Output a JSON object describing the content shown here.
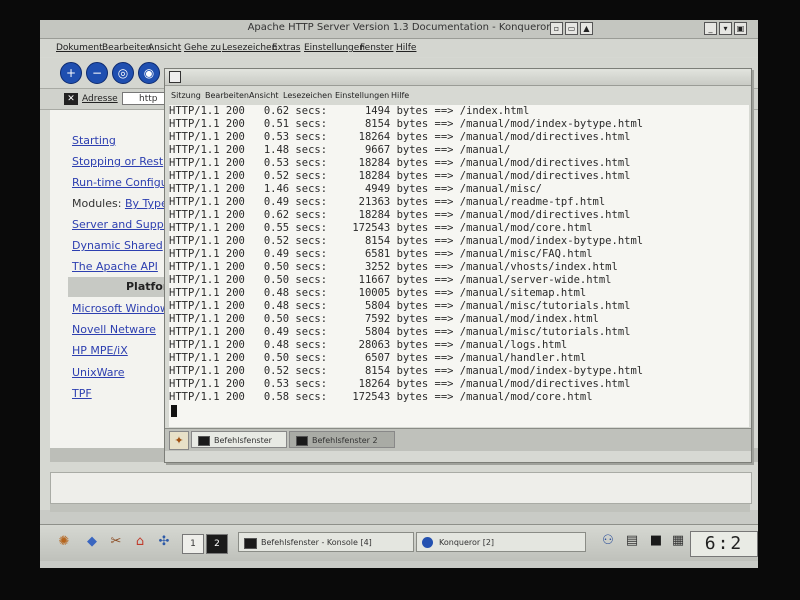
{
  "konqueror": {
    "title": "Apache HTTP Server Version 1.3 Documentation - Konqueror",
    "menu": [
      "Dokument",
      "Bearbeiten",
      "Ansicht",
      "Gehe zu",
      "Lesezeichen",
      "Extras",
      "Einstellungen",
      "Fenster",
      "Hilfe"
    ],
    "location_label": "Adresse",
    "location_value": "http",
    "sidebar": {
      "starting": "Starting",
      "stopping": "Stopping or Rest",
      "runtime": "Run-time Configu",
      "modules_prefix": "Modules: ",
      "modules_link": "By Type",
      "server": "Server and Suppo",
      "dynamic": "Dynamic Shared",
      "api": "The Apache API",
      "platform_heading": "Platfor",
      "microsoft": "Microsoft Window",
      "novell": "Novell Netware",
      "hp": "HP MPE/iX",
      "unixware": "UnixWare",
      "tpf": "TPF"
    }
  },
  "konsole": {
    "menu": [
      "Sitzung",
      "Bearbeiten",
      "Ansicht",
      "Lesezeichen",
      "Einstellungen",
      "Hilfe"
    ],
    "tabs": [
      "Befehlsfenster",
      "Befehlsfenster 2"
    ],
    "log": [
      {
        "status": "HTTP/1.1 200",
        "time": "0.62",
        "bytes": "1494",
        "path": "/index.html"
      },
      {
        "status": "HTTP/1.1 200",
        "time": "0.51",
        "bytes": "8154",
        "path": "/manual/mod/index-bytype.html"
      },
      {
        "status": "HTTP/1.1 200",
        "time": "0.53",
        "bytes": "18264",
        "path": "/manual/mod/directives.html"
      },
      {
        "status": "HTTP/1.1 200",
        "time": "1.48",
        "bytes": "9667",
        "path": "/manual/"
      },
      {
        "status": "HTTP/1.1 200",
        "time": "0.53",
        "bytes": "18284",
        "path": "/manual/mod/directives.html"
      },
      {
        "status": "HTTP/1.1 200",
        "time": "0.52",
        "bytes": "18284",
        "path": "/manual/mod/directives.html"
      },
      {
        "status": "HTTP/1.1 200",
        "time": "1.46",
        "bytes": "4949",
        "path": "/manual/misc/"
      },
      {
        "status": "HTTP/1.1 200",
        "time": "0.49",
        "bytes": "21363",
        "path": "/manual/readme-tpf.html"
      },
      {
        "status": "HTTP/1.1 200",
        "time": "0.62",
        "bytes": "18284",
        "path": "/manual/mod/directives.html"
      },
      {
        "status": "HTTP/1.1 200",
        "time": "0.55",
        "bytes": "172543",
        "path": "/manual/mod/core.html"
      },
      {
        "status": "HTTP/1.1 200",
        "time": "0.52",
        "bytes": "8154",
        "path": "/manual/mod/index-bytype.html"
      },
      {
        "status": "HTTP/1.1 200",
        "time": "0.49",
        "bytes": "6581",
        "path": "/manual/misc/FAQ.html"
      },
      {
        "status": "HTTP/1.1 200",
        "time": "0.50",
        "bytes": "3252",
        "path": "/manual/vhosts/index.html"
      },
      {
        "status": "HTTP/1.1 200",
        "time": "0.50",
        "bytes": "11667",
        "path": "/manual/server-wide.html"
      },
      {
        "status": "HTTP/1.1 200",
        "time": "0.48",
        "bytes": "10005",
        "path": "/manual/sitemap.html"
      },
      {
        "status": "HTTP/1.1 200",
        "time": "0.48",
        "bytes": "5804",
        "path": "/manual/misc/tutorials.html"
      },
      {
        "status": "HTTP/1.1 200",
        "time": "0.50",
        "bytes": "7592",
        "path": "/manual/mod/index.html"
      },
      {
        "status": "HTTP/1.1 200",
        "time": "0.49",
        "bytes": "5804",
        "path": "/manual/misc/tutorials.html"
      },
      {
        "status": "HTTP/1.1 200",
        "time": "0.48",
        "bytes": "28063",
        "path": "/manual/logs.html"
      },
      {
        "status": "HTTP/1.1 200",
        "time": "0.50",
        "bytes": "6507",
        "path": "/manual/handler.html"
      },
      {
        "status": "HTTP/1.1 200",
        "time": "0.52",
        "bytes": "8154",
        "path": "/manual/mod/index-bytype.html"
      },
      {
        "status": "HTTP/1.1 200",
        "time": "0.53",
        "bytes": "18264",
        "path": "/manual/mod/directives.html"
      },
      {
        "status": "HTTP/1.1 200",
        "time": "0.58",
        "bytes": "172543",
        "path": "/manual/mod/core.html"
      }
    ],
    "secs_word": "secs:",
    "bytes_word": "bytes",
    "arrow": "==>"
  },
  "panel": {
    "pager": [
      "1",
      "2"
    ],
    "tasks": [
      "Befehlsfenster - Konsole [4]",
      "Konqueror [2]"
    ],
    "clock": "6:2"
  }
}
